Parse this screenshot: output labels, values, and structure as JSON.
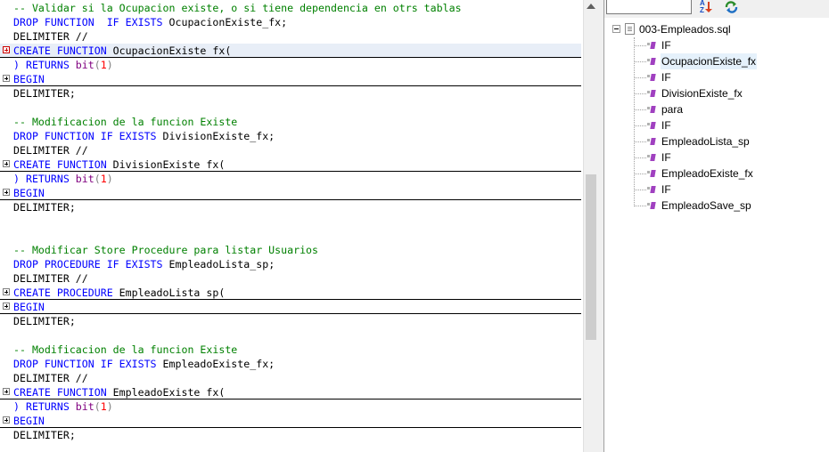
{
  "editor": {
    "lines": [
      {
        "segs": [
          {
            "t": "-- Validar si la Ocupacion existe, o si tiene dependencia en otrs tablas",
            "c": "cm"
          }
        ]
      },
      {
        "segs": [
          {
            "t": "DROP FUNCTION  IF EXISTS",
            "c": "kw"
          },
          {
            "t": " OcupacionExiste_fx;",
            "c": ""
          }
        ]
      },
      {
        "segs": [
          {
            "t": "DELIMITER //",
            "c": ""
          }
        ]
      },
      {
        "fold": "red",
        "underline": true,
        "highlight": true,
        "segs": [
          {
            "t": "CREATE FUNCTION",
            "c": "kw"
          },
          {
            "t": " OcupacionExiste fx(",
            "c": ""
          }
        ]
      },
      {
        "segs": [
          {
            "t": ") RETURNS",
            "c": "kw"
          },
          {
            "t": " bit",
            "c": "typ"
          },
          {
            "t": "(",
            "c": "punc"
          },
          {
            "t": "1",
            "c": "num"
          },
          {
            "t": ")",
            "c": "punc"
          }
        ]
      },
      {
        "fold": "plus",
        "underline": true,
        "segs": [
          {
            "t": "BEGIN",
            "c": "kw"
          }
        ]
      },
      {
        "segs": [
          {
            "t": "DELIMITER;",
            "c": ""
          }
        ]
      },
      {
        "segs": []
      },
      {
        "segs": [
          {
            "t": "-- Modificacion de la funcion Existe",
            "c": "cm"
          }
        ]
      },
      {
        "segs": [
          {
            "t": "DROP FUNCTION IF EXISTS",
            "c": "kw"
          },
          {
            "t": " DivisionExiste_fx;",
            "c": ""
          }
        ]
      },
      {
        "segs": [
          {
            "t": "DELIMITER //",
            "c": ""
          }
        ]
      },
      {
        "fold": "plus",
        "underline": true,
        "segs": [
          {
            "t": "CREATE FUNCTION",
            "c": "kw"
          },
          {
            "t": " DivisionExiste fx(",
            "c": ""
          }
        ]
      },
      {
        "segs": [
          {
            "t": ") RETURNS",
            "c": "kw"
          },
          {
            "t": " bit",
            "c": "typ"
          },
          {
            "t": "(",
            "c": "punc"
          },
          {
            "t": "1",
            "c": "num"
          },
          {
            "t": ")",
            "c": "punc"
          }
        ]
      },
      {
        "fold": "plus",
        "underline": true,
        "segs": [
          {
            "t": "BEGIN",
            "c": "kw"
          }
        ]
      },
      {
        "segs": [
          {
            "t": "DELIMITER;",
            "c": ""
          }
        ]
      },
      {
        "segs": []
      },
      {
        "segs": []
      },
      {
        "segs": [
          {
            "t": "-- Modificar Store Procedure para listar Usuarios",
            "c": "cm"
          }
        ]
      },
      {
        "segs": [
          {
            "t": "DROP PROCEDURE IF EXISTS",
            "c": "kw"
          },
          {
            "t": " EmpleadoLista_sp;",
            "c": ""
          }
        ]
      },
      {
        "segs": [
          {
            "t": "DELIMITER //",
            "c": ""
          }
        ]
      },
      {
        "fold": "plus",
        "underline": true,
        "segs": [
          {
            "t": "CREATE PROCEDURE",
            "c": "kw"
          },
          {
            "t": " EmpleadoLista sp(",
            "c": ""
          }
        ]
      },
      {
        "fold": "plus",
        "underline": true,
        "segs": [
          {
            "t": "BEGIN",
            "c": "kw"
          }
        ]
      },
      {
        "segs": [
          {
            "t": "DELIMITER;",
            "c": ""
          }
        ]
      },
      {
        "segs": []
      },
      {
        "segs": [
          {
            "t": "-- Modificacion de la funcion Existe",
            "c": "cm"
          }
        ]
      },
      {
        "segs": [
          {
            "t": "DROP FUNCTION IF EXISTS",
            "c": "kw"
          },
          {
            "t": " EmpleadoExiste_fx;",
            "c": ""
          }
        ]
      },
      {
        "segs": [
          {
            "t": "DELIMITER //",
            "c": ""
          }
        ]
      },
      {
        "fold": "plus",
        "underline": true,
        "segs": [
          {
            "t": "CREATE FUNCTION",
            "c": "kw"
          },
          {
            "t": " EmpleadoExiste fx(",
            "c": ""
          }
        ]
      },
      {
        "segs": [
          {
            "t": ") RETURNS",
            "c": "kw"
          },
          {
            "t": " bit",
            "c": "typ"
          },
          {
            "t": "(",
            "c": "punc"
          },
          {
            "t": "1",
            "c": "num"
          },
          {
            "t": ")",
            "c": "punc"
          }
        ]
      },
      {
        "fold": "plus",
        "underline": true,
        "segs": [
          {
            "t": "BEGIN",
            "c": "kw"
          }
        ]
      },
      {
        "segs": [
          {
            "t": "DELIMITER;",
            "c": ""
          }
        ]
      }
    ]
  },
  "panel": {
    "filter_value": "",
    "sort_icon": "sort-az-icon",
    "refresh_icon": "refresh-icon",
    "root_label": "003-Empleados.sql",
    "items": [
      {
        "label": "IF"
      },
      {
        "label": "OcupacionExiste_fx",
        "selected": true
      },
      {
        "label": "IF"
      },
      {
        "label": "DivisionExiste_fx"
      },
      {
        "label": "para"
      },
      {
        "label": "IF"
      },
      {
        "label": "EmpleadoLista_sp"
      },
      {
        "label": "IF"
      },
      {
        "label": "EmpleadoExiste_fx"
      },
      {
        "label": "IF"
      },
      {
        "label": "EmpleadoSave_sp"
      }
    ]
  },
  "colors": {
    "keyword": "#0000ff",
    "comment": "#008000",
    "number": "#ff0000",
    "type": "#800080",
    "selection": "#e5f1fb"
  }
}
